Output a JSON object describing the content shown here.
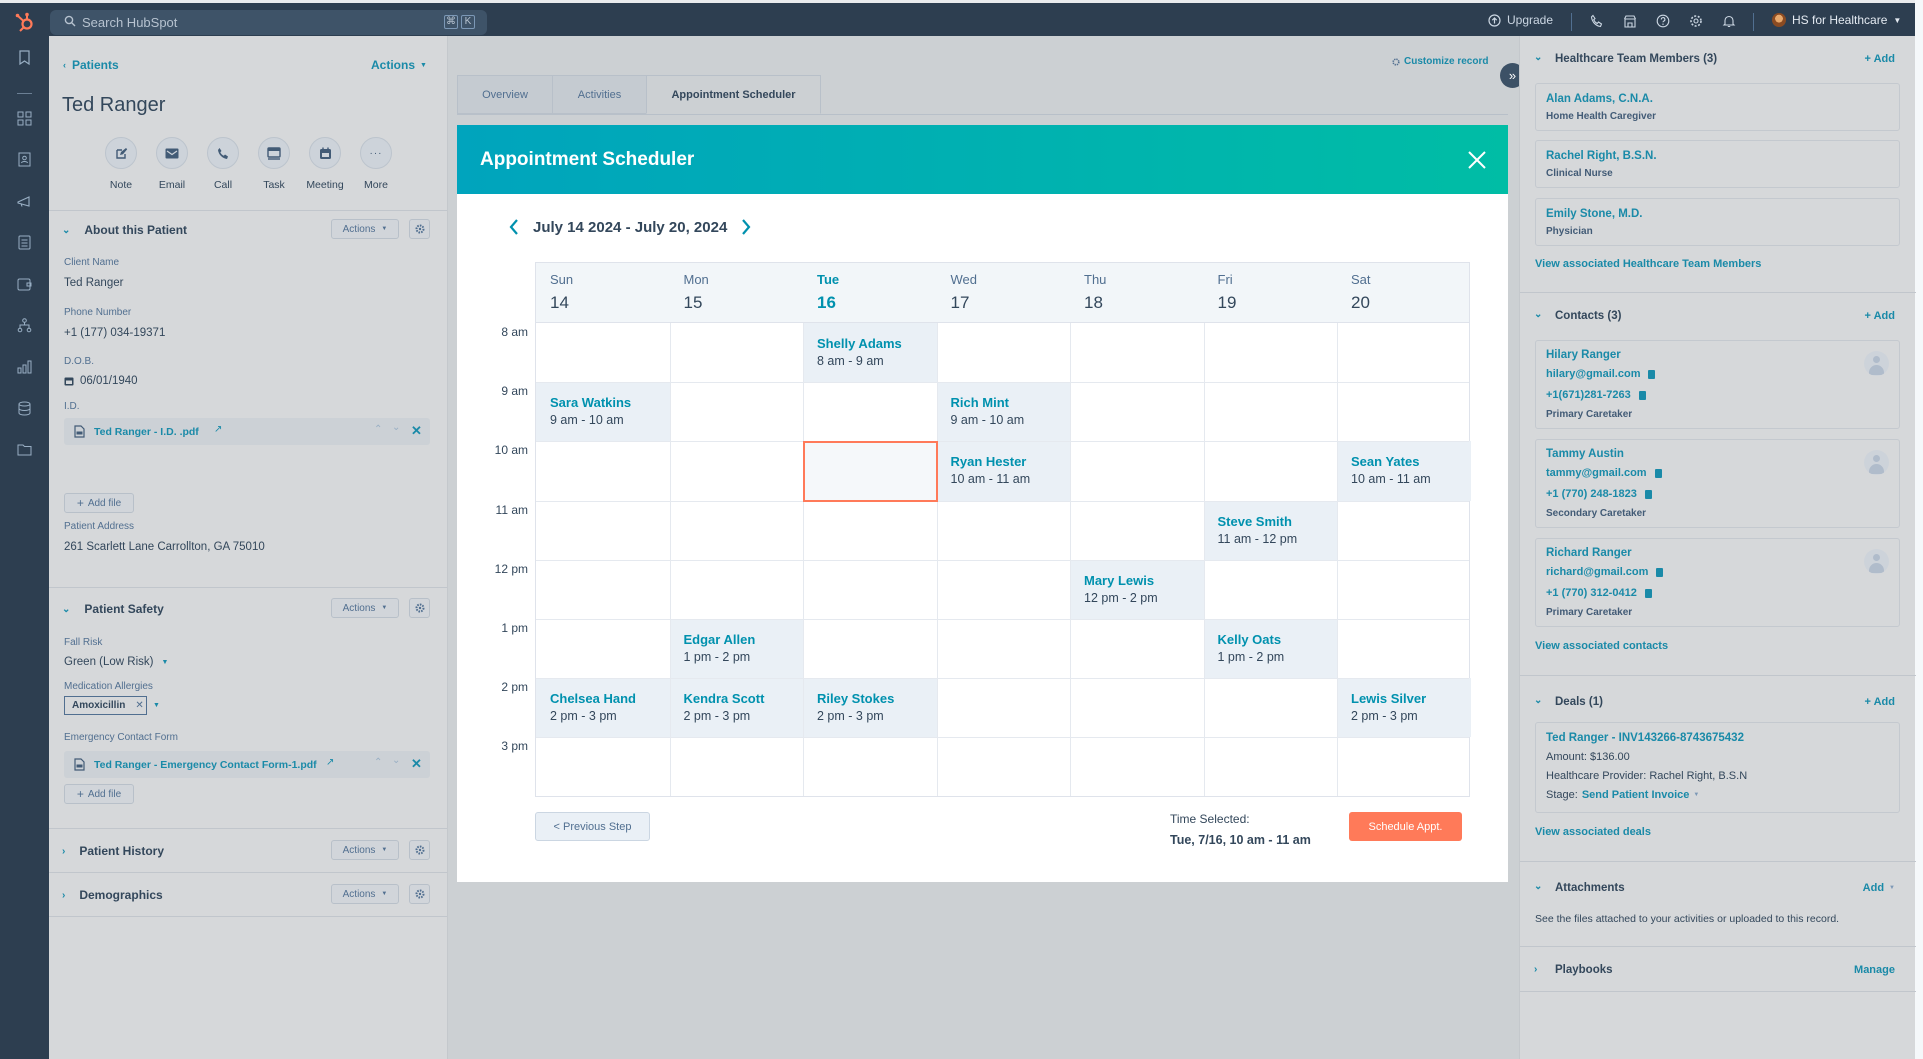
{
  "topbar": {
    "search_placeholder": "Search HubSpot",
    "shortcut_keys": [
      "⌘",
      "K"
    ],
    "upgrade_label": "Upgrade",
    "account_name": "HS for Healthcare",
    "icons": [
      "phone-icon",
      "marketplace-icon",
      "help-icon",
      "settings-icon",
      "notifications-icon"
    ]
  },
  "rail": {
    "icons": [
      "bookmark-icon",
      "workspaces-icon",
      "contacts-icon",
      "marketing-icon",
      "content-icon",
      "commerce-icon",
      "automation-icon",
      "reporting-icon",
      "data-icon",
      "library-icon"
    ]
  },
  "record": {
    "breadcrumb": "Patients",
    "actions_label": "Actions",
    "name": "Ted Ranger",
    "quick_actions": [
      {
        "label": "Note",
        "icon": "note-icon"
      },
      {
        "label": "Email",
        "icon": "email-icon"
      },
      {
        "label": "Call",
        "icon": "call-icon"
      },
      {
        "label": "Task",
        "icon": "task-icon"
      },
      {
        "label": "Meeting",
        "icon": "meeting-icon"
      },
      {
        "label": "More",
        "icon": "more-icon"
      }
    ],
    "sections": {
      "about": {
        "title": "About this Patient",
        "actions_label": "Actions",
        "fields": {
          "client_name_label": "Client Name",
          "client_name": "Ted Ranger",
          "phone_label": "Phone Number",
          "phone": "+1 (177) 034-19371",
          "dob_label": "D.O.B.",
          "dob": "06/01/1940",
          "id_label": "I.D.",
          "id_file": "Ted Ranger - I.D. .pdf",
          "add_file": "Add file",
          "address_label": "Patient Address",
          "address": "261 Scarlett Lane Carrollton, GA 75010"
        }
      },
      "safety": {
        "title": "Patient Safety",
        "actions_label": "Actions",
        "fall_risk_label": "Fall Risk",
        "fall_risk": "Green (Low Risk)",
        "allergies_label": "Medication Allergies",
        "allergy_tag": "Amoxicillin",
        "emergency_label": "Emergency Contact Form",
        "emergency_file": "Ted Ranger - Emergency Contact Form-1.pdf",
        "add_file": "Add file"
      },
      "history": {
        "title": "Patient History",
        "actions_label": "Actions"
      },
      "demographics": {
        "title": "Demographics",
        "actions_label": "Actions"
      }
    }
  },
  "middle": {
    "customize_label": "Customize record",
    "tabs": [
      {
        "label": "Overview",
        "active": false
      },
      {
        "label": "Activities",
        "active": false
      },
      {
        "label": "Appointment Scheduler",
        "active": true
      }
    ]
  },
  "scheduler": {
    "title": "Appointment Scheduler",
    "date_range": "July 14 2024 - July 20, 2024",
    "days": [
      {
        "name": "Sun",
        "date": "14",
        "today": false
      },
      {
        "name": "Mon",
        "date": "15",
        "today": false
      },
      {
        "name": "Tue",
        "date": "16",
        "today": true
      },
      {
        "name": "Wed",
        "date": "17",
        "today": false
      },
      {
        "name": "Thu",
        "date": "18",
        "today": false
      },
      {
        "name": "Fri",
        "date": "19",
        "today": false
      },
      {
        "name": "Sat",
        "date": "20",
        "today": false
      }
    ],
    "times": [
      "8 am",
      "9 am",
      "10 am",
      "11 am",
      "12 pm",
      "1 pm",
      "2 pm",
      "3 pm"
    ],
    "events": [
      {
        "name": "Shelly Adams",
        "time": "8 am - 9 am",
        "day": 2,
        "slot": 0
      },
      {
        "name": "Sara Watkins",
        "time": "9 am - 10 am",
        "day": 0,
        "slot": 1
      },
      {
        "name": "Rich Mint",
        "time": "9 am - 10 am",
        "day": 3,
        "slot": 1
      },
      {
        "name": "Ryan Hester",
        "time": "10 am - 11 am",
        "day": 3,
        "slot": 2
      },
      {
        "name": "Sean Yates",
        "time": "10 am - 11 am",
        "day": 6,
        "slot": 2
      },
      {
        "name": "Steve Smith",
        "time": "11 am - 12 pm",
        "day": 5,
        "slot": 3
      },
      {
        "name": "Mary Lewis",
        "time": "12 pm - 2 pm",
        "day": 4,
        "slot": 4
      },
      {
        "name": "Edgar Allen",
        "time": "1 pm - 2 pm",
        "day": 1,
        "slot": 5
      },
      {
        "name": "Kelly Oats",
        "time": "1 pm - 2 pm",
        "day": 5,
        "slot": 5
      },
      {
        "name": "Chelsea Hand",
        "time": "2 pm - 3 pm",
        "day": 0,
        "slot": 6
      },
      {
        "name": "Kendra Scott",
        "time": "2 pm - 3 pm",
        "day": 1,
        "slot": 6
      },
      {
        "name": "Riley Stokes",
        "time": "2 pm - 3 pm",
        "day": 2,
        "slot": 6
      },
      {
        "name": "Lewis Silver",
        "time": "2 pm - 3 pm",
        "day": 6,
        "slot": 6
      }
    ],
    "selected": {
      "day": 2,
      "slot": 2
    },
    "prev_step_label": "< Previous Step",
    "time_selected_label": "Time Selected:",
    "time_selected_value": "Tue, 7/16, 10 am - 11 am",
    "schedule_label": "Schedule Appt.",
    "colors": {
      "accent": "#ff7a59",
      "teal": "#00a4bd",
      "event_bg": "#eaf0f6"
    }
  },
  "sidebar": {
    "team": {
      "title": "Healthcare Team Members (3)",
      "add_label": "+ Add",
      "members": [
        {
          "name": "Alan Adams, C.N.A.",
          "role": "Home Health Caregiver"
        },
        {
          "name": "Rachel Right, B.S.N.",
          "role": "Clinical Nurse"
        },
        {
          "name": "Emily Stone, M.D.",
          "role": "Physician"
        }
      ],
      "view_link": "View associated Healthcare Team Members"
    },
    "contacts": {
      "title": "Contacts (3)",
      "add_label": "+ Add",
      "items": [
        {
          "name": "Hilary Ranger",
          "email": "hilary@gmail.com",
          "phone": "+1(671)281-7263",
          "role": "Primary Caretaker"
        },
        {
          "name": "Tammy Austin",
          "email": "tammy@gmail.com",
          "phone": "+1 (770) 248-1823",
          "role": "Secondary Caretaker"
        },
        {
          "name": "Richard Ranger",
          "email": "richard@gmail.com",
          "phone": "+1 (770) 312-0412",
          "role": "Primary Caretaker"
        }
      ],
      "view_link": "View associated contacts"
    },
    "deals": {
      "title": "Deals (1)",
      "add_label": "+ Add",
      "deal": {
        "name": "Ted Ranger - INV143266-8743675432",
        "amount": "Amount: $136.00",
        "provider": "Healthcare Provider:  Rachel Right, B.S.N",
        "stage_label": "Stage:",
        "stage": "Send Patient Invoice"
      },
      "view_link": "View associated deals"
    },
    "attachments": {
      "title": "Attachments",
      "add_label": "Add",
      "description": "See the files attached to your activities or uploaded to this record."
    },
    "playbooks": {
      "title": "Playbooks",
      "manage_label": "Manage"
    }
  }
}
